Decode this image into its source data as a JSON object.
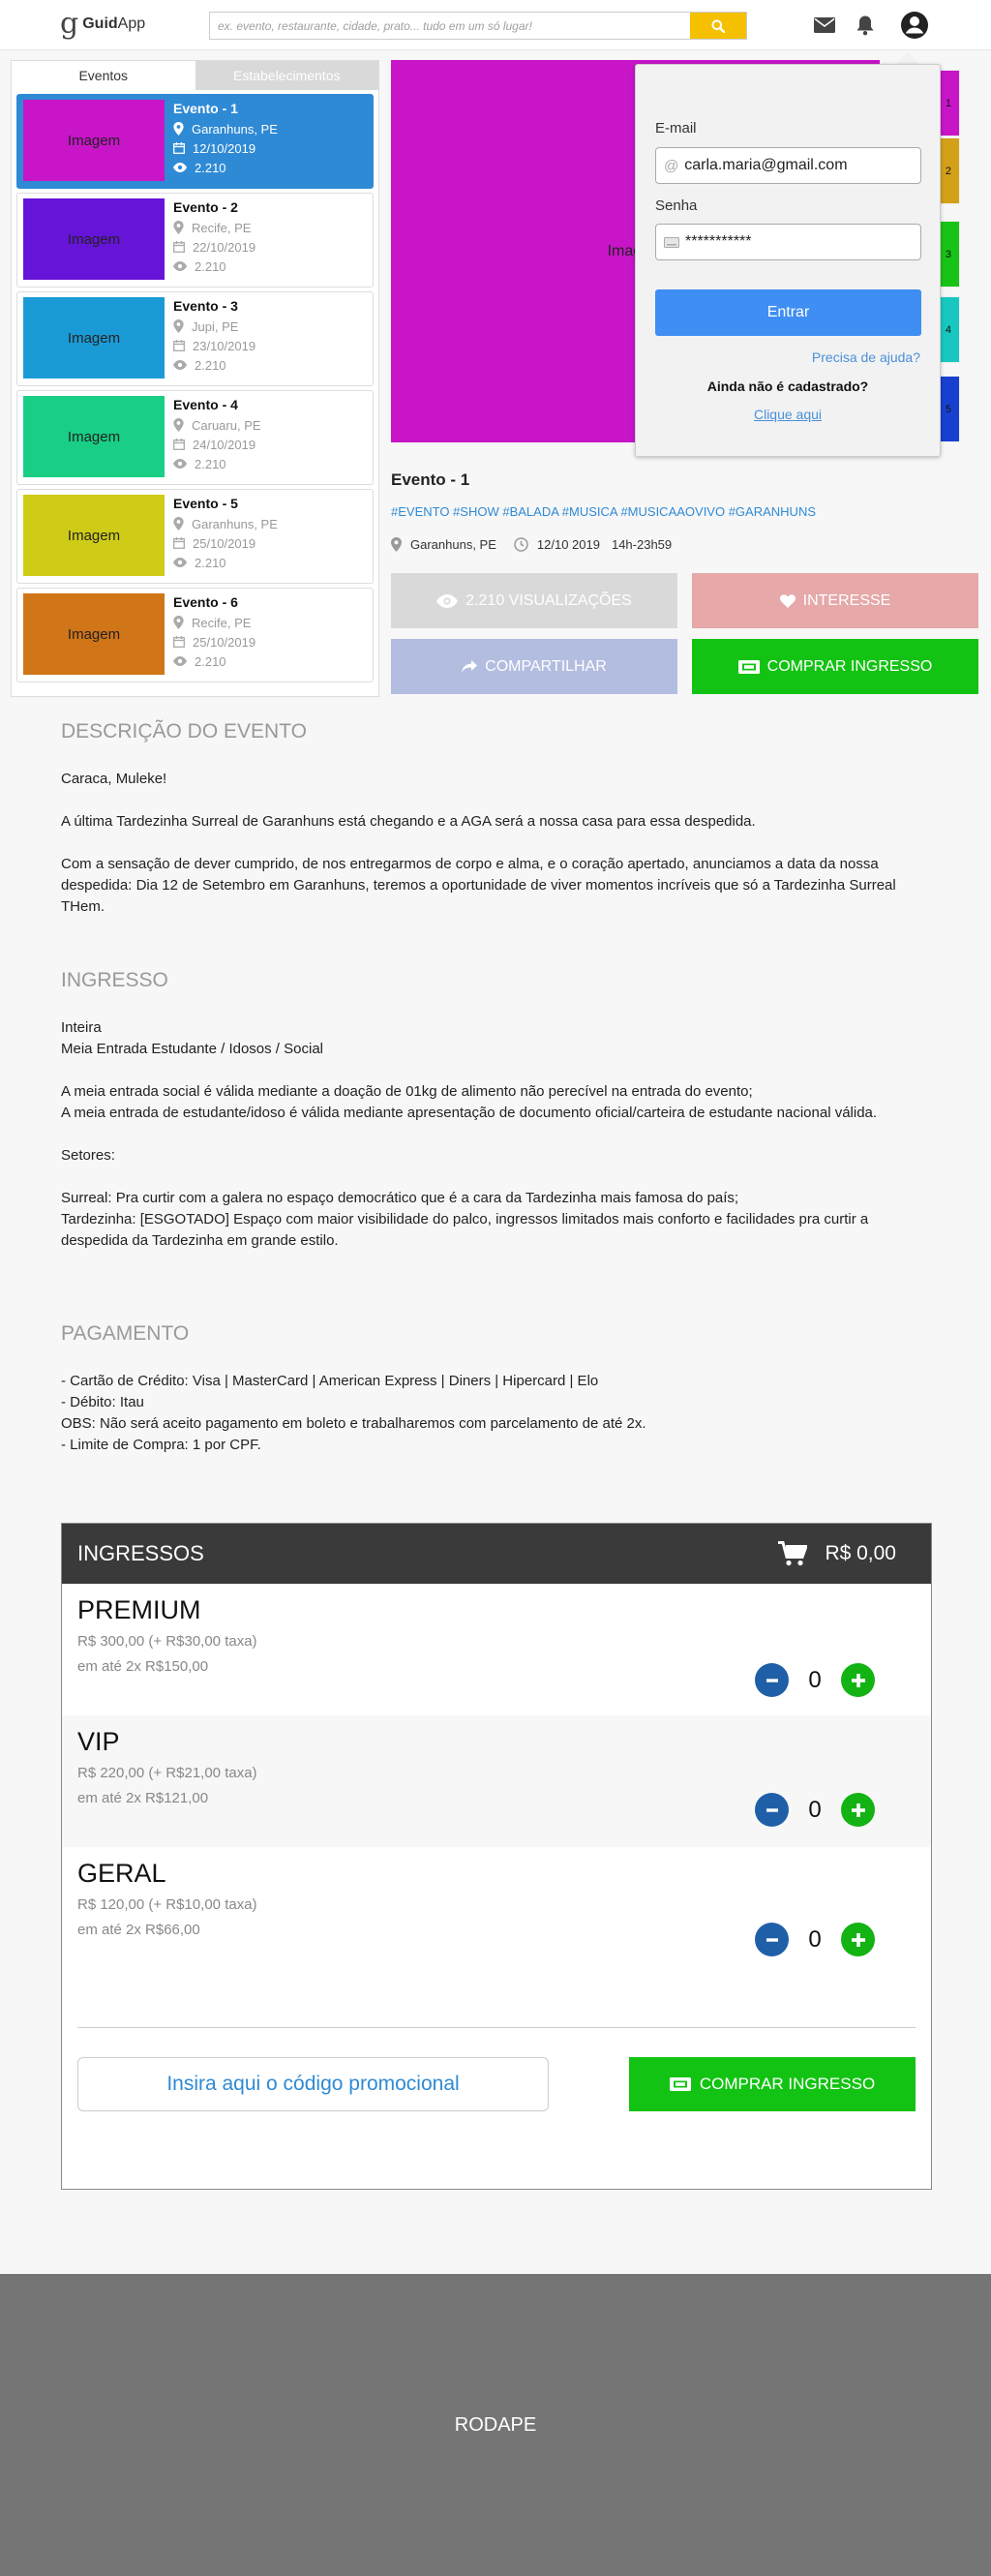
{
  "header": {
    "logo_mark": "g",
    "logo_bold": "Guid",
    "logo_rest": "App",
    "search_placeholder": "ex. evento, restaurante, cidade, prato... tudo em um só lugar!"
  },
  "sidebar": {
    "tabs": [
      "Eventos",
      "Estabelecimentos"
    ],
    "events": [
      {
        "title": "Evento - 1",
        "img": "Imagem",
        "img_color": "#c815c8",
        "location": "Garanhuns, PE",
        "date": "12/10/2019",
        "views": "2.210"
      },
      {
        "title": "Evento - 2",
        "img": "Imagem",
        "img_color": "#6614d8",
        "location": "Recife, PE",
        "date": "22/10/2019",
        "views": "2.210"
      },
      {
        "title": "Evento - 3",
        "img": "Imagem",
        "img_color": "#1b9bd6",
        "location": "Jupi, PE",
        "date": "23/10/2019",
        "views": "2.210"
      },
      {
        "title": "Evento - 4",
        "img": "Imagem",
        "img_color": "#18cf85",
        "location": "Caruaru, PE",
        "date": "24/10/2019",
        "views": "2.210"
      },
      {
        "title": "Evento - 5",
        "img": "Imagem",
        "img_color": "#cfcc18",
        "location": "Garanhuns, PE",
        "date": "25/10/2019",
        "views": "2.210"
      },
      {
        "title": "Evento - 6",
        "img": "Imagem",
        "img_color": "#d07518",
        "location": "Recife, PE",
        "date": "25/10/2019",
        "views": "2.210"
      }
    ]
  },
  "gallery": {
    "main_label": "Imagem",
    "thumbs": [
      {
        "label": "1",
        "color": "#c815c8"
      },
      {
        "label": "2",
        "color": "#d4a018"
      },
      {
        "label": "3",
        "color": "#18c318"
      },
      {
        "label": "4",
        "color": "#18c8c0"
      },
      {
        "label": "5",
        "color": "#1840d0"
      }
    ]
  },
  "event": {
    "title": "Evento - 1",
    "tags": "#EVENTO #SHOW #BALADA #MUSICA #MUSICAAOVIVO #GARANHUNS",
    "location": "Garanhuns, PE",
    "date": "12/10 2019",
    "time": "14h-23h59"
  },
  "actions": {
    "views": "2.210 VISUALIZAÇÕES",
    "interest": "INTERESSE",
    "share": "COMPARTILHAR",
    "buy": "COMPRAR INGRESSO"
  },
  "login": {
    "email_label": "E-mail",
    "email_value": "carla.maria@gmail.com",
    "password_label": "Senha",
    "password_value": "***********",
    "submit": "Entrar",
    "help": "Precisa de ajuda?",
    "not_registered": "Ainda não é cadastrado?",
    "click_here": "Clique aqui"
  },
  "description": {
    "heading": "DESCRIÇÃO DO EVENTO",
    "paragraphs": [
      "Caraca, Muleke!",
      "A última Tardezinha Surreal de Garanhuns está chegando e a AGA será a nossa casa para essa despedida.",
      "Com a sensação de dever cumprido, de nos entregarmos de corpo e alma, e o coração apertado, anunciamos a data da nossa despedida:  Dia 12 de Setembro em Garanhuns, teremos a oportunidade de viver momentos incríveis que só a Tardezinha Surreal THem."
    ]
  },
  "ingresso": {
    "heading": "INGRESSO",
    "lines": [
      "Inteira",
      "Meia Entrada Estudante / Idosos / Social",
      "A meia entrada social é válida mediante a doação de 01kg de alimento não perecível na entrada do evento;",
      "A meia entrada de estudante/idoso é válida mediante apresentação de documento oficial/carteira de estudante nacional válida.",
      "Setores:",
      "Surreal: Pra curtir com a galera no espaço democrático que é a cara da Tardezinha mais famosa do país;",
      "Tardezinha: [ESGOTADO] Espaço com maior visibilidade do palco, ingressos limitados mais conforto e facilidades pra curtir a despedida da Tardezinha em grande estilo."
    ]
  },
  "pagamento": {
    "heading": "PAGAMENTO",
    "lines": [
      "- Cartão de Crédito: Visa | MasterCard | American Express | Diners | Hipercard | Elo",
      "- Débito: Itau",
      "OBS: Não será aceito pagamento em boleto e trabalharemos com parcelamento de até 2x.",
      "- Limite de Compra: 1 por CPF."
    ]
  },
  "tickets": {
    "heading": "INGRESSOS",
    "cart_total": "R$ 0,00",
    "items": [
      {
        "name": "PREMIUM",
        "price": "R$ 300,00 (+ R$30,00 taxa)",
        "installments": "em até 2x R$150,00",
        "qty": "0"
      },
      {
        "name": "VIP",
        "price": "R$ 220,00 (+ R$21,00 taxa)",
        "installments": "em até 2x R$121,00",
        "qty": "0"
      },
      {
        "name": "GERAL",
        "price": "R$ 120,00 (+ R$10,00 taxa)",
        "installments": "em até 2x R$66,00",
        "qty": "0"
      }
    ],
    "promo_placeholder": "Insira aqui o código promocional",
    "buy": "COMPRAR INGRESSO"
  },
  "footer": {
    "label": "RODAPE"
  },
  "colors": {
    "accent_blue": "#2f8ad5",
    "search_yellow": "#f5c000",
    "buy_green": "#13c313",
    "interest_pink": "#e6a8a8",
    "share_blue": "#b3bde0",
    "views_gray": "#d9d9d9"
  }
}
